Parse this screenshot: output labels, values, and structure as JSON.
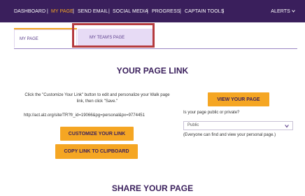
{
  "nav": {
    "items": [
      {
        "label": "DASHBOARD"
      },
      {
        "label": "MY PAGE"
      },
      {
        "label": "SEND EMAIL"
      },
      {
        "label": "SOCIAL MEDIA"
      },
      {
        "label": "PROGRESS"
      },
      {
        "label": "CAPTAIN TOOLS"
      }
    ],
    "active": "MY PAGE",
    "alerts_label": "ALERTS",
    "alerts_icon": "chevron-down-icon",
    "separator": "|"
  },
  "tabs": [
    {
      "label": "MY PAGE"
    },
    {
      "label": "MY TEAM'S PAGE"
    }
  ],
  "page_link": {
    "title": "YOUR PAGE LINK",
    "instructions": "Click the \"Customize Your Link\" button to edit and personalize your Walk page link, then click \"Save.\"",
    "url": "http://act.alz.org/site/TR?fr_id=19066&pg=personal&px=9774451",
    "customize_label": "CUSTOMIZE YOUR LINK",
    "copy_label": "COPY LINK TO CLIPBOARD",
    "view_label": "VIEW YOUR PAGE",
    "privacy_question": "Is your page public or private?",
    "privacy_value": "Public",
    "privacy_note": "(Everyone can find and view your personal page.)"
  },
  "share": {
    "title": "SHARE YOUR PAGE"
  },
  "colors": {
    "nav_bg": "#3a1f5c",
    "accent": "#f5a623",
    "highlight": "#b53b3f",
    "tab_inactive_bg": "#e7dbf5"
  }
}
